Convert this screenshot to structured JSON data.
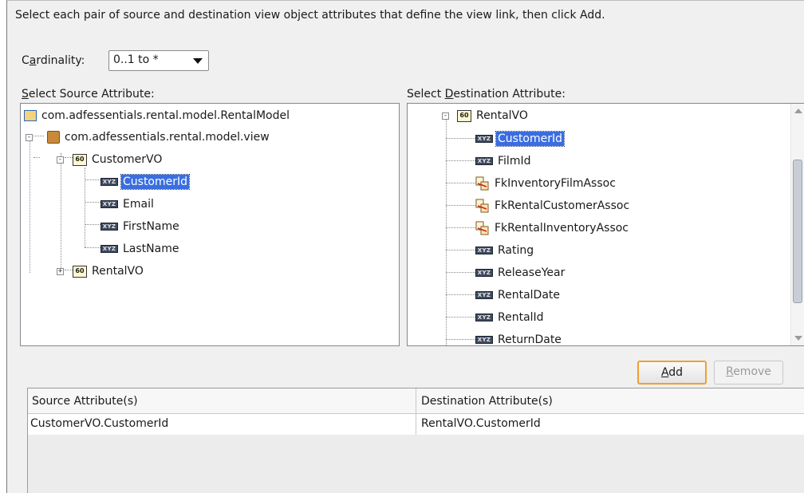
{
  "instruction": "Select each pair of source and destination view object attributes that define the view link, then click Add.",
  "cardinality": {
    "label_prefix": "C",
    "label_underlined": "a",
    "label_rest": "rdinality:",
    "value": "0..1 to *"
  },
  "source": {
    "label_underlined": "S",
    "label_rest": "elect Source Attribute:",
    "project": "com.adfessentials.rental.model.RentalModel",
    "package": "com.adfessentials.rental.model.view",
    "customer_vo": "CustomerVO",
    "customer_attrs": [
      "CustomerId",
      "Email",
      "FirstName",
      "LastName"
    ],
    "rental_vo": "RentalVO",
    "selected": "CustomerId"
  },
  "destination": {
    "label_prefix": "Select ",
    "label_underlined": "D",
    "label_rest": "estination Attribute:",
    "vo": "RentalVO",
    "attrs": [
      {
        "name": "CustomerId",
        "kind": "attribute"
      },
      {
        "name": "FilmId",
        "kind": "attribute"
      },
      {
        "name": "FkInventoryFilmAssoc",
        "kind": "association"
      },
      {
        "name": "FkRentalCustomerAssoc",
        "kind": "association"
      },
      {
        "name": "FkRentalInventoryAssoc",
        "kind": "association"
      },
      {
        "name": "Rating",
        "kind": "attribute"
      },
      {
        "name": "ReleaseYear",
        "kind": "attribute"
      },
      {
        "name": "RentalDate",
        "kind": "attribute"
      },
      {
        "name": "RentalId",
        "kind": "attribute"
      },
      {
        "name": "ReturnDate",
        "kind": "attribute"
      }
    ],
    "selected": "CustomerId"
  },
  "buttons": {
    "add_underlined": "A",
    "add_rest": "dd",
    "remove_underlined": "R",
    "remove_rest": "emove"
  },
  "table": {
    "headers": [
      "Source Attribute(s)",
      "Destination Attribute(s)"
    ],
    "rows": [
      [
        "CustomerVO.CustomerId",
        "RentalVO.CustomerId"
      ]
    ]
  },
  "icons": {
    "attribute": "xyz-attribute-icon",
    "view_object": "view-object-icon",
    "association": "association-icon",
    "package": "package-icon",
    "project": "project-icon"
  },
  "colors": {
    "selection": "#3a6ee0",
    "add_focus_border": "#f0a030"
  }
}
